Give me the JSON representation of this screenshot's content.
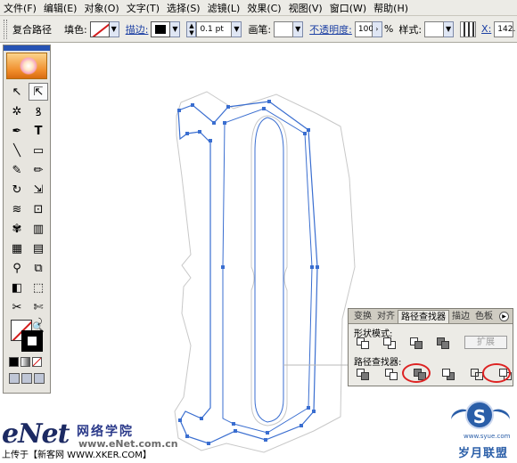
{
  "menu": [
    "文件(F)",
    "编辑(E)",
    "对象(O)",
    "文字(T)",
    "选择(S)",
    "滤镜(L)",
    "效果(C)",
    "视图(V)",
    "窗口(W)",
    "帮助(H)"
  ],
  "control": {
    "object_type": "复合路径",
    "fill_label": "填色:",
    "stroke_label": "描边:",
    "stroke_weight": "0.1 pt",
    "brush_label": "画笔:",
    "opacity_label": "不透明度:",
    "opacity_value": "100",
    "percent": "%",
    "style_label": "样式:",
    "x_label": "X:",
    "x_value": "142."
  },
  "tools": {
    "icons": [
      "selection-icon",
      "direct-selection-icon",
      "magic-wand-icon",
      "lasso-icon",
      "pen-icon",
      "type-icon",
      "line-segment-icon",
      "rectangle-icon",
      "paintbrush-icon",
      "pencil-icon",
      "rotate-icon",
      "scale-icon",
      "warp-icon",
      "free-transform-icon",
      "symbol-sprayer-icon",
      "column-graph-icon",
      "mesh-icon",
      "gradient-icon",
      "eyedropper-icon",
      "blend-icon",
      "live-paint-bucket-icon",
      "live-paint-selection-icon",
      "slice-icon",
      "scissors-icon",
      "hand-icon",
      "zoom-icon"
    ],
    "glyphs": [
      "↖",
      "⇱",
      "✲",
      "ꝸ",
      "✒",
      "T",
      "╲",
      "▭",
      "✎",
      "✏",
      "↻",
      "⇲",
      "≋",
      "⊡",
      "✾",
      "▥",
      "▦",
      "▤",
      "⚲",
      "⧉",
      "◧",
      "⬚",
      "✂",
      "✄",
      "✋",
      "🔍"
    ]
  },
  "pathfinder": {
    "tabs": [
      "变换",
      "对齐",
      "路径查找器",
      "描边",
      "色板"
    ],
    "active_tab": 2,
    "shape_modes_label": "形状模式:",
    "expand_label": "扩展",
    "pathfinders_label": "路径查找器:"
  },
  "watermark": {
    "brand": "eNet",
    "cn": "网络学院",
    "url": "www.eNet.com.cn",
    "upload": "上传于【新客网 WWW.XKER.COM】",
    "right_site": "岁月联盟",
    "right_url": "www.syue.com"
  },
  "colors": {
    "path_blue": "#3a6ed0",
    "guide_gray": "#b8b8b8",
    "highlight_red": "#d22222"
  }
}
